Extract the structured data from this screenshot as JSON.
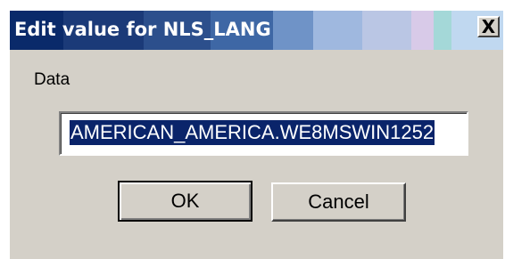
{
  "dialog": {
    "title": "Edit value for NLS_LANG",
    "close_label": "X"
  },
  "form": {
    "data_label": "Data",
    "data_value": "AMERICAN_AMERICA.WE8MSWIN1252"
  },
  "buttons": {
    "ok_label": "OK",
    "cancel_label": "Cancel"
  },
  "colors": {
    "selection": "#0a246a",
    "dialog_face": "#d4d0c8",
    "title_text": "#ffffff"
  }
}
